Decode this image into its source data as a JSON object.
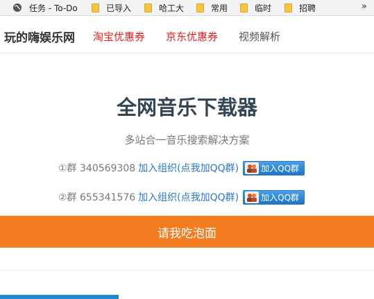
{
  "bookmarks": {
    "items": [
      {
        "label": "任务 - To-Do",
        "icon": "globe-icon"
      },
      {
        "label": "已导入",
        "icon": "folder-icon"
      },
      {
        "label": "哈工大",
        "icon": "folder-icon"
      },
      {
        "label": "常用",
        "icon": "folder-icon"
      },
      {
        "label": "临时",
        "icon": "folder-icon"
      },
      {
        "label": "招聘",
        "icon": "folder-icon"
      }
    ],
    "more": "»"
  },
  "nav": {
    "brand": "玩的嗨娱乐网",
    "links": [
      "淘宝优惠券",
      "京东优惠券",
      "视频解析"
    ]
  },
  "main": {
    "title": "全网音乐下载器",
    "subtitle": "多站合一音乐搜索解决方案",
    "groups": [
      {
        "number": "①群 340569308",
        "link": "加入组织(点我加QQ群)",
        "button": "加入QQ群"
      },
      {
        "number": "②群 655341576",
        "link": "加入组织(点我加QQ群)",
        "button": "加入QQ群"
      }
    ],
    "donate_label": "请我吃泡面"
  },
  "colors": {
    "accent_orange": "#f47c20",
    "link_blue": "#2a77c9",
    "nav_red": "#e02020"
  }
}
